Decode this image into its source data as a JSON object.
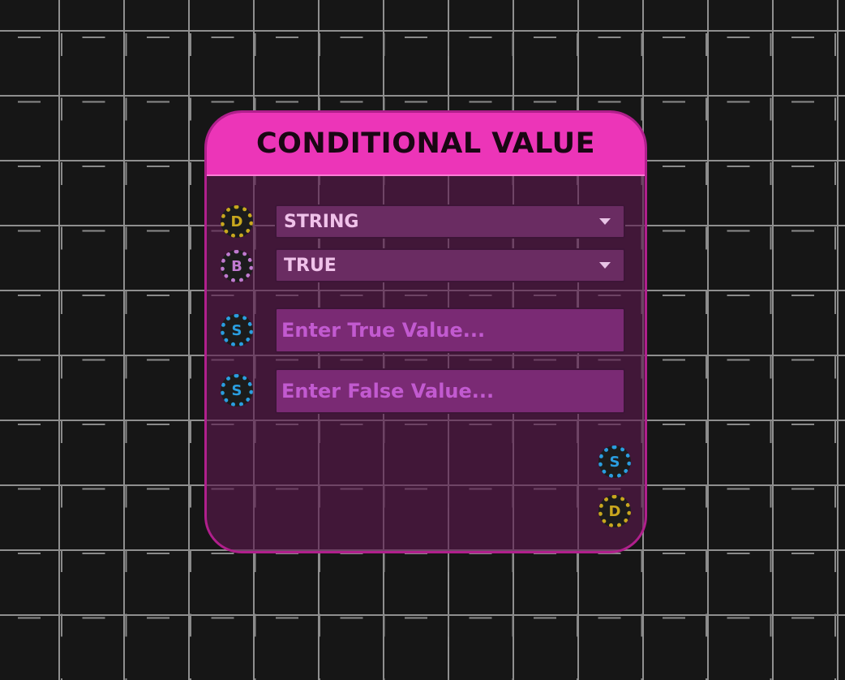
{
  "node": {
    "title": "CONDITIONAL VALUE",
    "header_color": "#ec35b8",
    "type_dropdown": {
      "selected": "STRING"
    },
    "condition_dropdown": {
      "selected": "TRUE"
    },
    "true_input": {
      "placeholder": "Enter True Value...",
      "value": ""
    },
    "false_input": {
      "placeholder": "Enter False Value...",
      "value": ""
    },
    "input_ports": [
      {
        "letter": "D",
        "color": "#c9a81e",
        "type": "dynamic"
      },
      {
        "letter": "B",
        "color": "#c07ad0",
        "type": "boolean"
      },
      {
        "letter": "S",
        "color": "#2a9ee0",
        "type": "string"
      },
      {
        "letter": "S",
        "color": "#2a9ee0",
        "type": "string"
      }
    ],
    "output_ports": [
      {
        "letter": "S",
        "color": "#2a9ee0",
        "type": "string"
      },
      {
        "letter": "D",
        "color": "#c9a81e",
        "type": "dynamic"
      }
    ]
  }
}
